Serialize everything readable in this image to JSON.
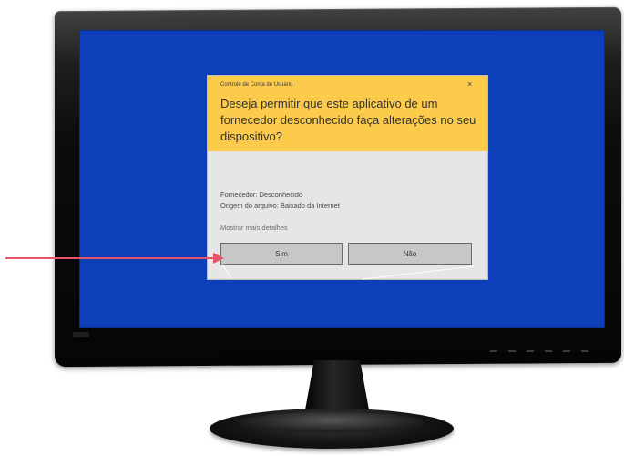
{
  "dialog": {
    "caption": "Controle de Conta de Usuário",
    "close_glyph": "×",
    "question": "Deseja permitir que este aplicativo de um fornecedor desconhecido faça alterações no seu dispositivo?",
    "publisher_line": "Fornecedor: Desconhecido",
    "origin_line": "Origem do arquivo: Baixado da Internet",
    "more_details": "Mostrar mais detalhes",
    "yes_label": "Sim",
    "no_label": "Não"
  },
  "colors": {
    "screen": "#0d3fb8",
    "dialog_header": "#fccb4b",
    "dialog_body": "#e6e6e6",
    "arrow": "#e8556a"
  },
  "icons": {
    "close": "close-icon",
    "arrow": "arrow-right-icon"
  }
}
